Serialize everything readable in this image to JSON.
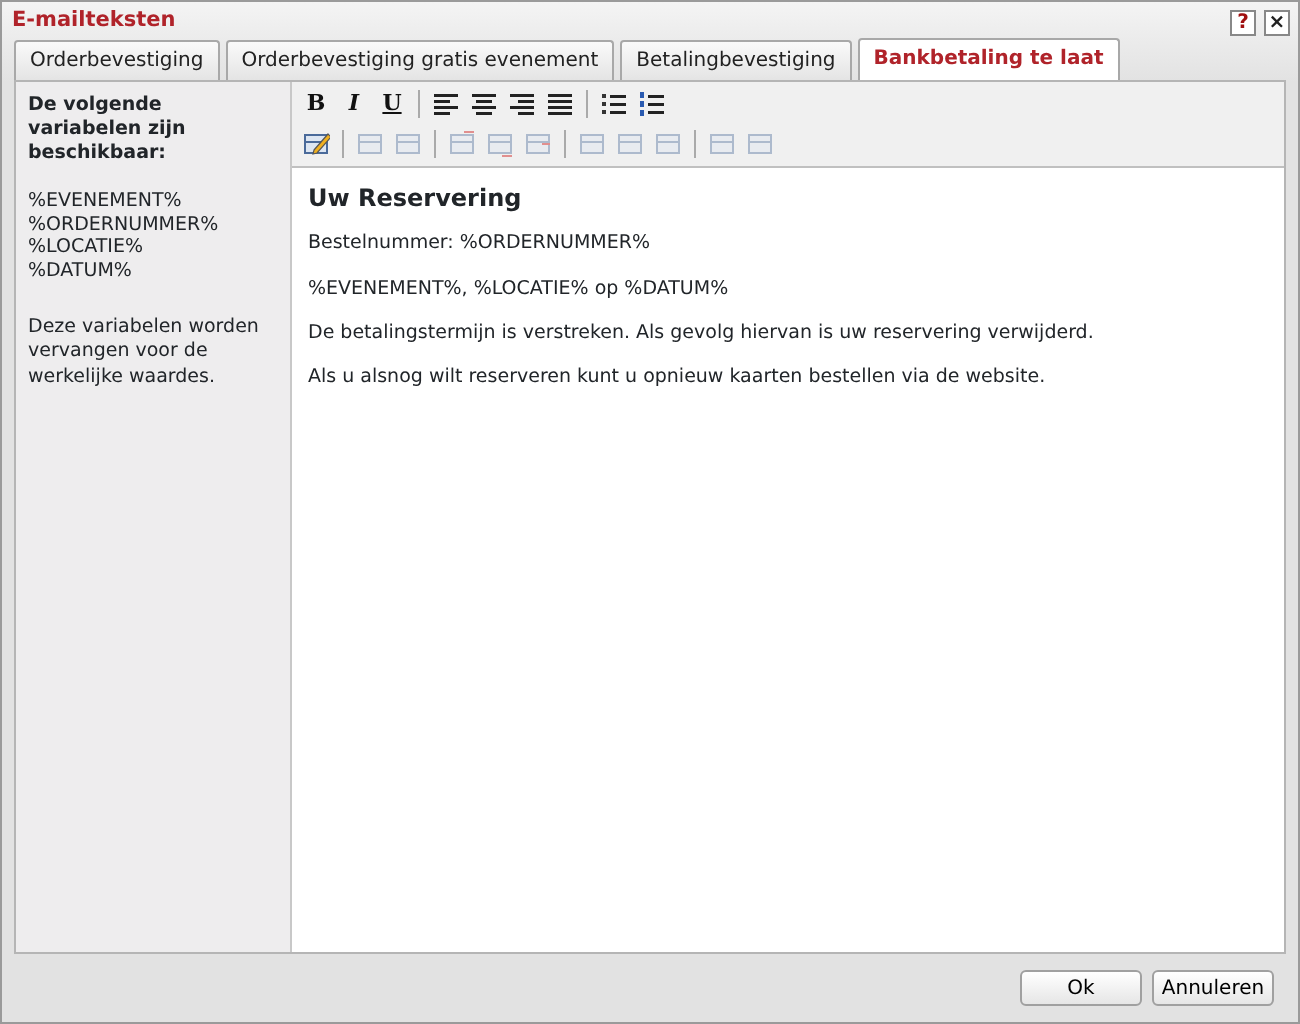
{
  "window": {
    "title": "E-mailteksten",
    "help": "?",
    "close": "×"
  },
  "tabs": [
    {
      "label": "Orderbevestiging",
      "selected": false
    },
    {
      "label": "Orderbevestiging gratis evenement",
      "selected": false
    },
    {
      "label": "Betalingbevestiging",
      "selected": false
    },
    {
      "label": "Bankbetaling te laat",
      "selected": true
    }
  ],
  "sidebar": {
    "heading": "De volgende variabelen zijn beschikbaar:",
    "variables": [
      "%EVENEMENT%",
      "%ORDERNUMMER%",
      "%LOCATIE%",
      "%DATUM%"
    ],
    "note": "Deze variabelen worden vervangen voor de werkelijke waardes."
  },
  "toolbar": [
    [
      {
        "kind": "bold",
        "label": "B",
        "disabled": false
      },
      {
        "kind": "italic",
        "label": "I",
        "disabled": false
      },
      {
        "kind": "underline",
        "label": "U",
        "disabled": false
      },
      {
        "kind": "separator"
      },
      {
        "kind": "align-left",
        "disabled": false
      },
      {
        "kind": "align-center",
        "disabled": false
      },
      {
        "kind": "align-right",
        "disabled": false
      },
      {
        "kind": "justify",
        "disabled": false
      },
      {
        "kind": "separator"
      },
      {
        "kind": "bullet-list",
        "disabled": false
      },
      {
        "kind": "numbered-list",
        "disabled": false
      }
    ],
    [
      {
        "kind": "edit",
        "disabled": false
      },
      {
        "kind": "separator"
      },
      {
        "kind": "table-row",
        "disabled": true
      },
      {
        "kind": "table-cell",
        "disabled": true
      },
      {
        "kind": "separator"
      },
      {
        "kind": "row-above",
        "disabled": true
      },
      {
        "kind": "row-below",
        "disabled": true
      },
      {
        "kind": "row-delete",
        "disabled": true
      },
      {
        "kind": "separator"
      },
      {
        "kind": "col-left",
        "disabled": true
      },
      {
        "kind": "col-right",
        "disabled": true
      },
      {
        "kind": "col-delete",
        "disabled": true
      },
      {
        "kind": "separator"
      },
      {
        "kind": "merge",
        "disabled": true
      },
      {
        "kind": "split",
        "disabled": true
      }
    ]
  ],
  "editor": {
    "heading": "Uw Reservering",
    "paragraphs": [
      "Bestelnummer: %ORDERNUMMER%",
      "%EVENEMENT%, %LOCATIE% op %DATUM%",
      "De betalingstermijn is verstreken. Als gevolg hiervan is uw reservering verwijderd.",
      "Als u alsnog wilt reserveren kunt u opnieuw kaarten bestellen via de website."
    ]
  },
  "buttons": [
    "Ok",
    "Annuleren"
  ]
}
